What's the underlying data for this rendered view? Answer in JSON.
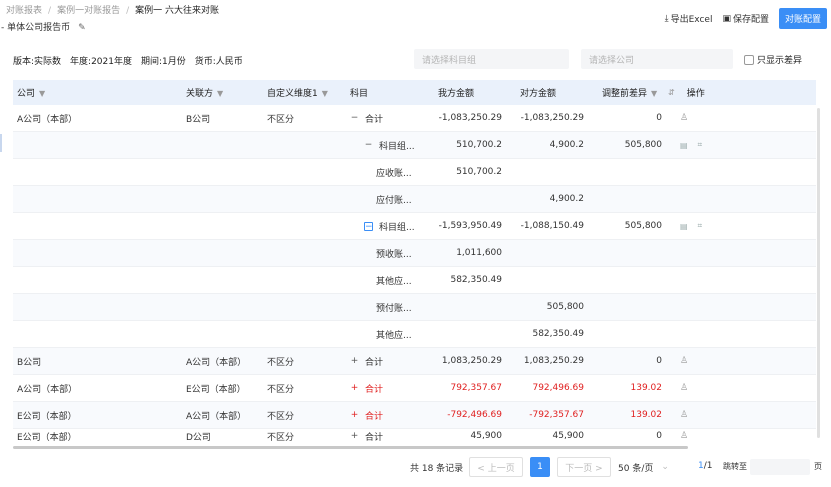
{
  "breadcrumb": {
    "items": [
      "对账报表",
      "案例一对账报告",
      "案例一 六大往来对账"
    ]
  },
  "subtitle": "- 单体公司报告币",
  "actions": {
    "export": "导出Excel",
    "save": "保存配置",
    "reconcile": "对账配置"
  },
  "meta": {
    "version": "版本:实际数",
    "year": "年度:2021年度",
    "period": "期间:1月份",
    "currency": "货币:人民币"
  },
  "filters": {
    "subject_placeholder": "请选择科目组",
    "company_placeholder": "请选择公司",
    "only_diff": "只显示差异"
  },
  "columns": {
    "company": "公司",
    "party": "关联方",
    "dim": "自定义维度1",
    "subject": "科目",
    "mine": "我方金额",
    "their": "对方金额",
    "diff": "调整前差异",
    "op": "操作"
  },
  "rows": [
    {
      "company": "A公司（本部）",
      "party": "B公司",
      "dim": "不区分",
      "subject": "合计",
      "mine": "-1,083,250.29",
      "their": "-1,083,250.29",
      "diff": "0"
    },
    {
      "company": "",
      "party": "",
      "dim": "",
      "subject": "科目组...",
      "mine": "510,700.2",
      "their": "4,900.2",
      "diff": "505,800"
    },
    {
      "company": "",
      "party": "",
      "dim": "",
      "subject": "应收账...",
      "mine": "510,700.2",
      "their": "",
      "diff": ""
    },
    {
      "company": "",
      "party": "",
      "dim": "",
      "subject": "应付账...",
      "mine": "",
      "their": "4,900.2",
      "diff": ""
    },
    {
      "company": "",
      "party": "",
      "dim": "",
      "subject": "科目组...",
      "mine": "-1,593,950.49",
      "their": "-1,088,150.49",
      "diff": "505,800"
    },
    {
      "company": "",
      "party": "",
      "dim": "",
      "subject": "预收账...",
      "mine": "1,011,600",
      "their": "",
      "diff": ""
    },
    {
      "company": "",
      "party": "",
      "dim": "",
      "subject": "其他应...",
      "mine": "582,350.49",
      "their": "",
      "diff": ""
    },
    {
      "company": "",
      "party": "",
      "dim": "",
      "subject": "预付账...",
      "mine": "",
      "their": "505,800",
      "diff": ""
    },
    {
      "company": "",
      "party": "",
      "dim": "",
      "subject": "其他应...",
      "mine": "",
      "their": "582,350.49",
      "diff": ""
    },
    {
      "company": "B公司",
      "party": "A公司（本部）",
      "dim": "不区分",
      "subject": "合计",
      "mine": "1,083,250.29",
      "their": "1,083,250.29",
      "diff": "0"
    },
    {
      "company": "A公司（本部）",
      "party": "E公司（本部）",
      "dim": "不区分",
      "subject": "合计",
      "mine": "792,357.67",
      "their": "792,496.69",
      "diff": "139.02"
    },
    {
      "company": "E公司（本部）",
      "party": "A公司（本部）",
      "dim": "不区分",
      "subject": "合计",
      "mine": "-792,496.69",
      "their": "-792,357.67",
      "diff": "139.02"
    },
    {
      "company": "E公司（本部）",
      "party": "D公司",
      "dim": "不区分",
      "subject": "合计",
      "mine": "45,900",
      "their": "45,900",
      "diff": "0"
    }
  ],
  "pager": {
    "total": "共 18 条记录",
    "prev": "< 上一页",
    "page": "1",
    "next": "下一页 >",
    "size": "50 条/页",
    "pagenum_cur": "1",
    "pagenum_total": "/1",
    "jump": "跳转至",
    "unit": "页"
  },
  "colors": {
    "primary": "#3a8ef6",
    "diff_red": "#e02020",
    "header_bg": "#eaf1fb"
  }
}
